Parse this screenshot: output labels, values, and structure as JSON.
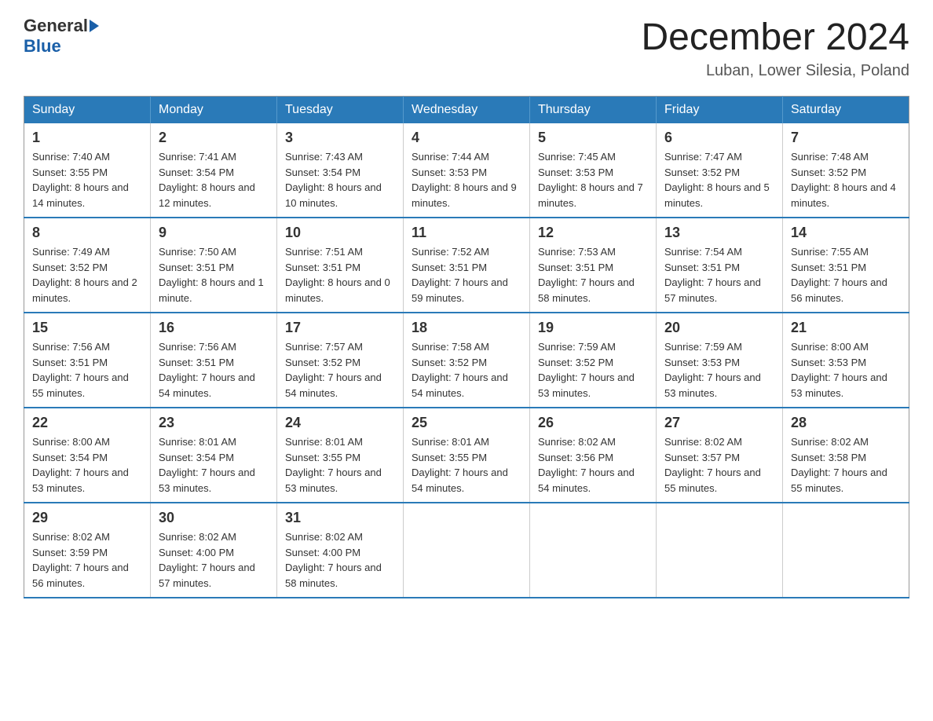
{
  "header": {
    "logo_general": "General",
    "logo_blue": "Blue",
    "month_title": "December 2024",
    "location": "Luban, Lower Silesia, Poland"
  },
  "days_of_week": [
    "Sunday",
    "Monday",
    "Tuesday",
    "Wednesday",
    "Thursday",
    "Friday",
    "Saturday"
  ],
  "weeks": [
    [
      {
        "day": "1",
        "sunrise": "7:40 AM",
        "sunset": "3:55 PM",
        "daylight": "8 hours and 14 minutes."
      },
      {
        "day": "2",
        "sunrise": "7:41 AM",
        "sunset": "3:54 PM",
        "daylight": "8 hours and 12 minutes."
      },
      {
        "day": "3",
        "sunrise": "7:43 AM",
        "sunset": "3:54 PM",
        "daylight": "8 hours and 10 minutes."
      },
      {
        "day": "4",
        "sunrise": "7:44 AM",
        "sunset": "3:53 PM",
        "daylight": "8 hours and 9 minutes."
      },
      {
        "day": "5",
        "sunrise": "7:45 AM",
        "sunset": "3:53 PM",
        "daylight": "8 hours and 7 minutes."
      },
      {
        "day": "6",
        "sunrise": "7:47 AM",
        "sunset": "3:52 PM",
        "daylight": "8 hours and 5 minutes."
      },
      {
        "day": "7",
        "sunrise": "7:48 AM",
        "sunset": "3:52 PM",
        "daylight": "8 hours and 4 minutes."
      }
    ],
    [
      {
        "day": "8",
        "sunrise": "7:49 AM",
        "sunset": "3:52 PM",
        "daylight": "8 hours and 2 minutes."
      },
      {
        "day": "9",
        "sunrise": "7:50 AM",
        "sunset": "3:51 PM",
        "daylight": "8 hours and 1 minute."
      },
      {
        "day": "10",
        "sunrise": "7:51 AM",
        "sunset": "3:51 PM",
        "daylight": "8 hours and 0 minutes."
      },
      {
        "day": "11",
        "sunrise": "7:52 AM",
        "sunset": "3:51 PM",
        "daylight": "7 hours and 59 minutes."
      },
      {
        "day": "12",
        "sunrise": "7:53 AM",
        "sunset": "3:51 PM",
        "daylight": "7 hours and 58 minutes."
      },
      {
        "day": "13",
        "sunrise": "7:54 AM",
        "sunset": "3:51 PM",
        "daylight": "7 hours and 57 minutes."
      },
      {
        "day": "14",
        "sunrise": "7:55 AM",
        "sunset": "3:51 PM",
        "daylight": "7 hours and 56 minutes."
      }
    ],
    [
      {
        "day": "15",
        "sunrise": "7:56 AM",
        "sunset": "3:51 PM",
        "daylight": "7 hours and 55 minutes."
      },
      {
        "day": "16",
        "sunrise": "7:56 AM",
        "sunset": "3:51 PM",
        "daylight": "7 hours and 54 minutes."
      },
      {
        "day": "17",
        "sunrise": "7:57 AM",
        "sunset": "3:52 PM",
        "daylight": "7 hours and 54 minutes."
      },
      {
        "day": "18",
        "sunrise": "7:58 AM",
        "sunset": "3:52 PM",
        "daylight": "7 hours and 54 minutes."
      },
      {
        "day": "19",
        "sunrise": "7:59 AM",
        "sunset": "3:52 PM",
        "daylight": "7 hours and 53 minutes."
      },
      {
        "day": "20",
        "sunrise": "7:59 AM",
        "sunset": "3:53 PM",
        "daylight": "7 hours and 53 minutes."
      },
      {
        "day": "21",
        "sunrise": "8:00 AM",
        "sunset": "3:53 PM",
        "daylight": "7 hours and 53 minutes."
      }
    ],
    [
      {
        "day": "22",
        "sunrise": "8:00 AM",
        "sunset": "3:54 PM",
        "daylight": "7 hours and 53 minutes."
      },
      {
        "day": "23",
        "sunrise": "8:01 AM",
        "sunset": "3:54 PM",
        "daylight": "7 hours and 53 minutes."
      },
      {
        "day": "24",
        "sunrise": "8:01 AM",
        "sunset": "3:55 PM",
        "daylight": "7 hours and 53 minutes."
      },
      {
        "day": "25",
        "sunrise": "8:01 AM",
        "sunset": "3:55 PM",
        "daylight": "7 hours and 54 minutes."
      },
      {
        "day": "26",
        "sunrise": "8:02 AM",
        "sunset": "3:56 PM",
        "daylight": "7 hours and 54 minutes."
      },
      {
        "day": "27",
        "sunrise": "8:02 AM",
        "sunset": "3:57 PM",
        "daylight": "7 hours and 55 minutes."
      },
      {
        "day": "28",
        "sunrise": "8:02 AM",
        "sunset": "3:58 PM",
        "daylight": "7 hours and 55 minutes."
      }
    ],
    [
      {
        "day": "29",
        "sunrise": "8:02 AM",
        "sunset": "3:59 PM",
        "daylight": "7 hours and 56 minutes."
      },
      {
        "day": "30",
        "sunrise": "8:02 AM",
        "sunset": "4:00 PM",
        "daylight": "7 hours and 57 minutes."
      },
      {
        "day": "31",
        "sunrise": "8:02 AM",
        "sunset": "4:00 PM",
        "daylight": "7 hours and 58 minutes."
      },
      {
        "day": "",
        "sunrise": "",
        "sunset": "",
        "daylight": ""
      },
      {
        "day": "",
        "sunrise": "",
        "sunset": "",
        "daylight": ""
      },
      {
        "day": "",
        "sunrise": "",
        "sunset": "",
        "daylight": ""
      },
      {
        "day": "",
        "sunrise": "",
        "sunset": "",
        "daylight": ""
      }
    ]
  ]
}
